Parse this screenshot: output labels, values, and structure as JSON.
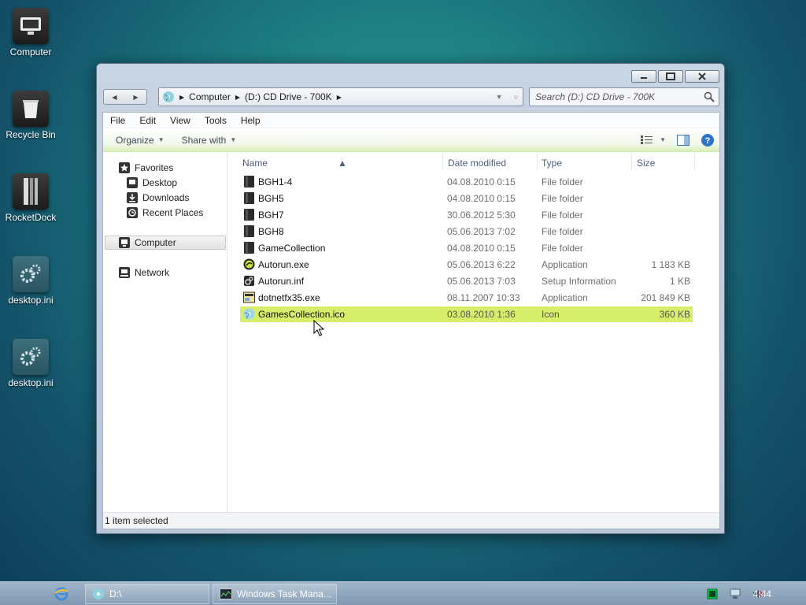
{
  "desktop": {
    "icons": [
      {
        "label": "Computer"
      },
      {
        "label": "Recycle Bin"
      },
      {
        "label": "RocketDock"
      },
      {
        "label": "desktop.ini"
      },
      {
        "label": "desktop.ini"
      }
    ]
  },
  "window": {
    "address": {
      "crumb_1": "Computer",
      "crumb_2": "(D:) CD Drive - 700K"
    },
    "search_placeholder": "Search (D:) CD Drive - 700K",
    "menu": [
      "File",
      "Edit",
      "View",
      "Tools",
      "Help"
    ],
    "toolbar": {
      "organize": "Organize",
      "share_with": "Share with"
    },
    "nav": {
      "favorites": "Favorites",
      "desktop": "Desktop",
      "downloads": "Downloads",
      "recent_places": "Recent Places",
      "computer": "Computer",
      "network": "Network"
    },
    "columns": {
      "name": "Name",
      "date": "Date modified",
      "type": "Type",
      "size": "Size"
    },
    "files": [
      {
        "name": "BGH1-4",
        "date": "04.08.2010 0:15",
        "type": "File folder",
        "size": "",
        "icon": "folder-icon"
      },
      {
        "name": "BGH5",
        "date": "04.08.2010 0:15",
        "type": "File folder",
        "size": "",
        "icon": "folder-icon"
      },
      {
        "name": "BGH7",
        "date": "30.06.2012 5:30",
        "type": "File folder",
        "size": "",
        "icon": "folder-icon"
      },
      {
        "name": "BGH8",
        "date": "05.06.2013 7:02",
        "type": "File folder",
        "size": "",
        "icon": "folder-icon"
      },
      {
        "name": "GameCollection",
        "date": "04.08.2010 0:15",
        "type": "File folder",
        "size": "",
        "icon": "folder-icon"
      },
      {
        "name": "Autorun.exe",
        "date": "05.06.2013 6:22",
        "type": "Application",
        "size": "1 183 KB",
        "icon": "app-icon"
      },
      {
        "name": "Autorun.inf",
        "date": "05.06.2013 7:03",
        "type": "Setup Information",
        "size": "1 KB",
        "icon": "settings-file-icon"
      },
      {
        "name": "dotnetfx35.exe",
        "date": "08.11.2007 10:33",
        "type": "Application",
        "size": "201 849 KB",
        "icon": "installer-icon"
      },
      {
        "name": "GamesCollection.ico",
        "date": "03.08.2010 1:36",
        "type": "Icon",
        "size": "360 KB",
        "icon": "ico-file-icon",
        "selected": true
      }
    ],
    "status": "1 item selected"
  },
  "taskbar": {
    "drive_label": "D:\\",
    "task_manager": "Windows Task Mana...",
    "clock": "4:44"
  },
  "colors": {
    "selection": "#d7ee6a",
    "toolbar_tint": "#d8f0b8",
    "desktop_teal": "#1d7f83"
  }
}
